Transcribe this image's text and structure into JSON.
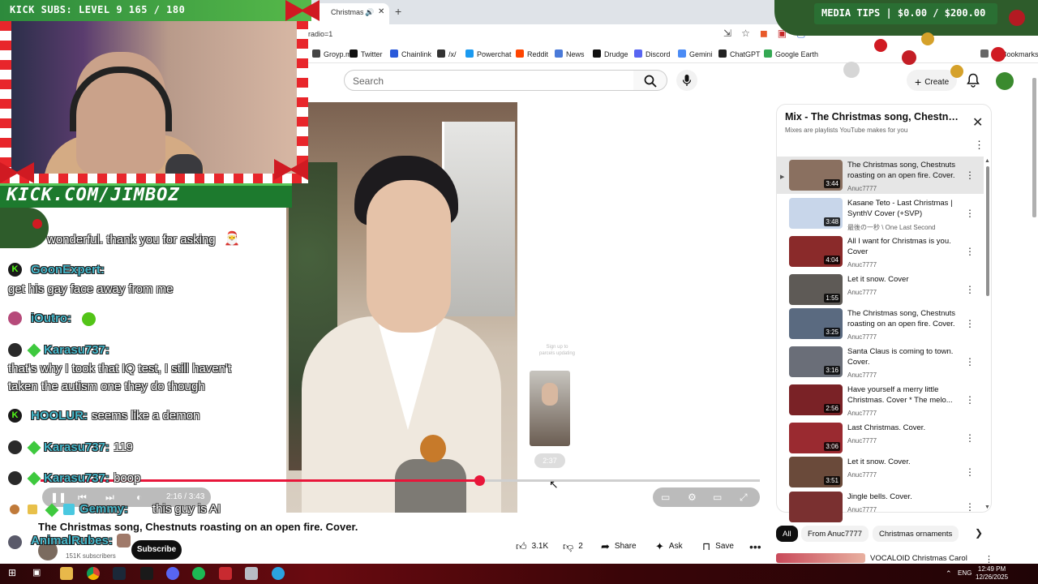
{
  "browser": {
    "tab_title": "Christmas song, Chestn",
    "url": "radio=1",
    "bookmarks": [
      "Groyp.me",
      "Twitter",
      "Chainlink",
      "/x/",
      "Powerchat",
      "Reddit",
      "News",
      "Drudge",
      "Discord",
      "Gemini",
      "ChatGPT",
      "Google Earth",
      "All Bookmarks"
    ],
    "bookmark_colors": [
      "#444",
      "#111",
      "#2a5ada",
      "#333",
      "#1b9af0",
      "#ff4500",
      "#4a7ad9",
      "#111",
      "#5865f2",
      "#4b8bf5",
      "#222",
      "#34a853",
      "#666"
    ]
  },
  "youtube": {
    "search_placeholder": "Search",
    "create_label": "Create",
    "video_title": "The Christmas song, Chestnuts roasting on an open fire. Cover.",
    "subscribers": "151K subscribers",
    "subscribe_label": "Subscribe",
    "likes": "3.1K",
    "dislikes": "2",
    "share_label": "Share",
    "ask_label": "Ask",
    "save_label": "Save",
    "player": {
      "time": "2:16 / 3:43",
      "progress": 0.61,
      "end_screen_time": "2:37",
      "end_screen_caption": "Sign up to parcels updating"
    }
  },
  "playlist": {
    "title": "Mix - The Christmas song, Chestnut...",
    "subtitle": "Mixes are playlists YouTube makes for you",
    "items": [
      {
        "title": "The Christmas song, Chestnuts roasting on an open fire. Cover.",
        "channel": "Anuc7777",
        "duration": "3:44",
        "current": true,
        "thumb": "#8a7060"
      },
      {
        "title": "Kasane Teto - Last Christmas | SynthV Cover (+SVP)",
        "channel": "最後の一秒 \\ One Last Second",
        "duration": "3:48",
        "current": false,
        "thumb": "#c8d6ea"
      },
      {
        "title": "All I want for Christmas is you. Cover",
        "channel": "Anuc7777",
        "duration": "4:04",
        "current": false,
        "thumb": "#8a2a2a"
      },
      {
        "title": "Let it snow. Cover",
        "channel": "Anuc7777",
        "duration": "1:55",
        "current": false,
        "thumb": "#5e5a56"
      },
      {
        "title": "The Christmas song, Chestnuts roasting on an open fire. Cover.",
        "channel": "Anuc7777",
        "duration": "3:25",
        "current": false,
        "thumb": "#5a6a80"
      },
      {
        "title": "Santa Claus is coming to town. Cover.",
        "channel": "Anuc7777",
        "duration": "3:16",
        "current": false,
        "thumb": "#6a6e78"
      },
      {
        "title": "Have yourself a merry little Christmas. Cover * The melo...",
        "channel": "Anuc7777",
        "duration": "2:56",
        "current": false,
        "thumb": "#7a2226"
      },
      {
        "title": "Last Christmas. Cover.",
        "channel": "Anuc7777",
        "duration": "3:06",
        "current": false,
        "thumb": "#9a2a30"
      },
      {
        "title": "Let it snow. Cover.",
        "channel": "Anuc7777",
        "duration": "3:51",
        "current": false,
        "thumb": "#6a4a3a"
      },
      {
        "title": "Jingle bells. Cover.",
        "channel": "Anuc7777",
        "duration": "",
        "current": false,
        "thumb": "#7a3030"
      }
    ]
  },
  "chips": [
    "All",
    "From Anuc7777",
    "Christmas ornaments"
  ],
  "recommendation": {
    "title": "VOCALOID Christmas Carol"
  },
  "stream": {
    "top_banner": "KICK SUBS: LEVEL 9 165 / 180",
    "media_tips": "MEDIA TIPS | $0.00 / $200.00",
    "kick_url": "KICK.COM/JIMBOZ"
  },
  "chat": [
    {
      "user": "",
      "text": "wonderful. thank you for asking"
    },
    {
      "user": "GoonExpert:",
      "text": "get his gay face away from me"
    },
    {
      "user": "iOutro:",
      "text": ""
    },
    {
      "user": "Karasu737:",
      "text": "that's why I took that IQ test, I still haven't"
    },
    {
      "user": "",
      "text": "taken the autism one they do though"
    },
    {
      "user": "HOOLUR:",
      "text": "seems like a demon"
    },
    {
      "user": "Karasu737:",
      "text": "119"
    },
    {
      "user": "Karasu737:",
      "text": "boop"
    },
    {
      "user": "Gemmy:",
      "text": "this guy is AI"
    },
    {
      "user": "AnimalRubes:",
      "text": ""
    }
  ],
  "taskbar": {
    "lang": "ENG",
    "time": "12:49 PM",
    "date": "12/26/2025"
  }
}
